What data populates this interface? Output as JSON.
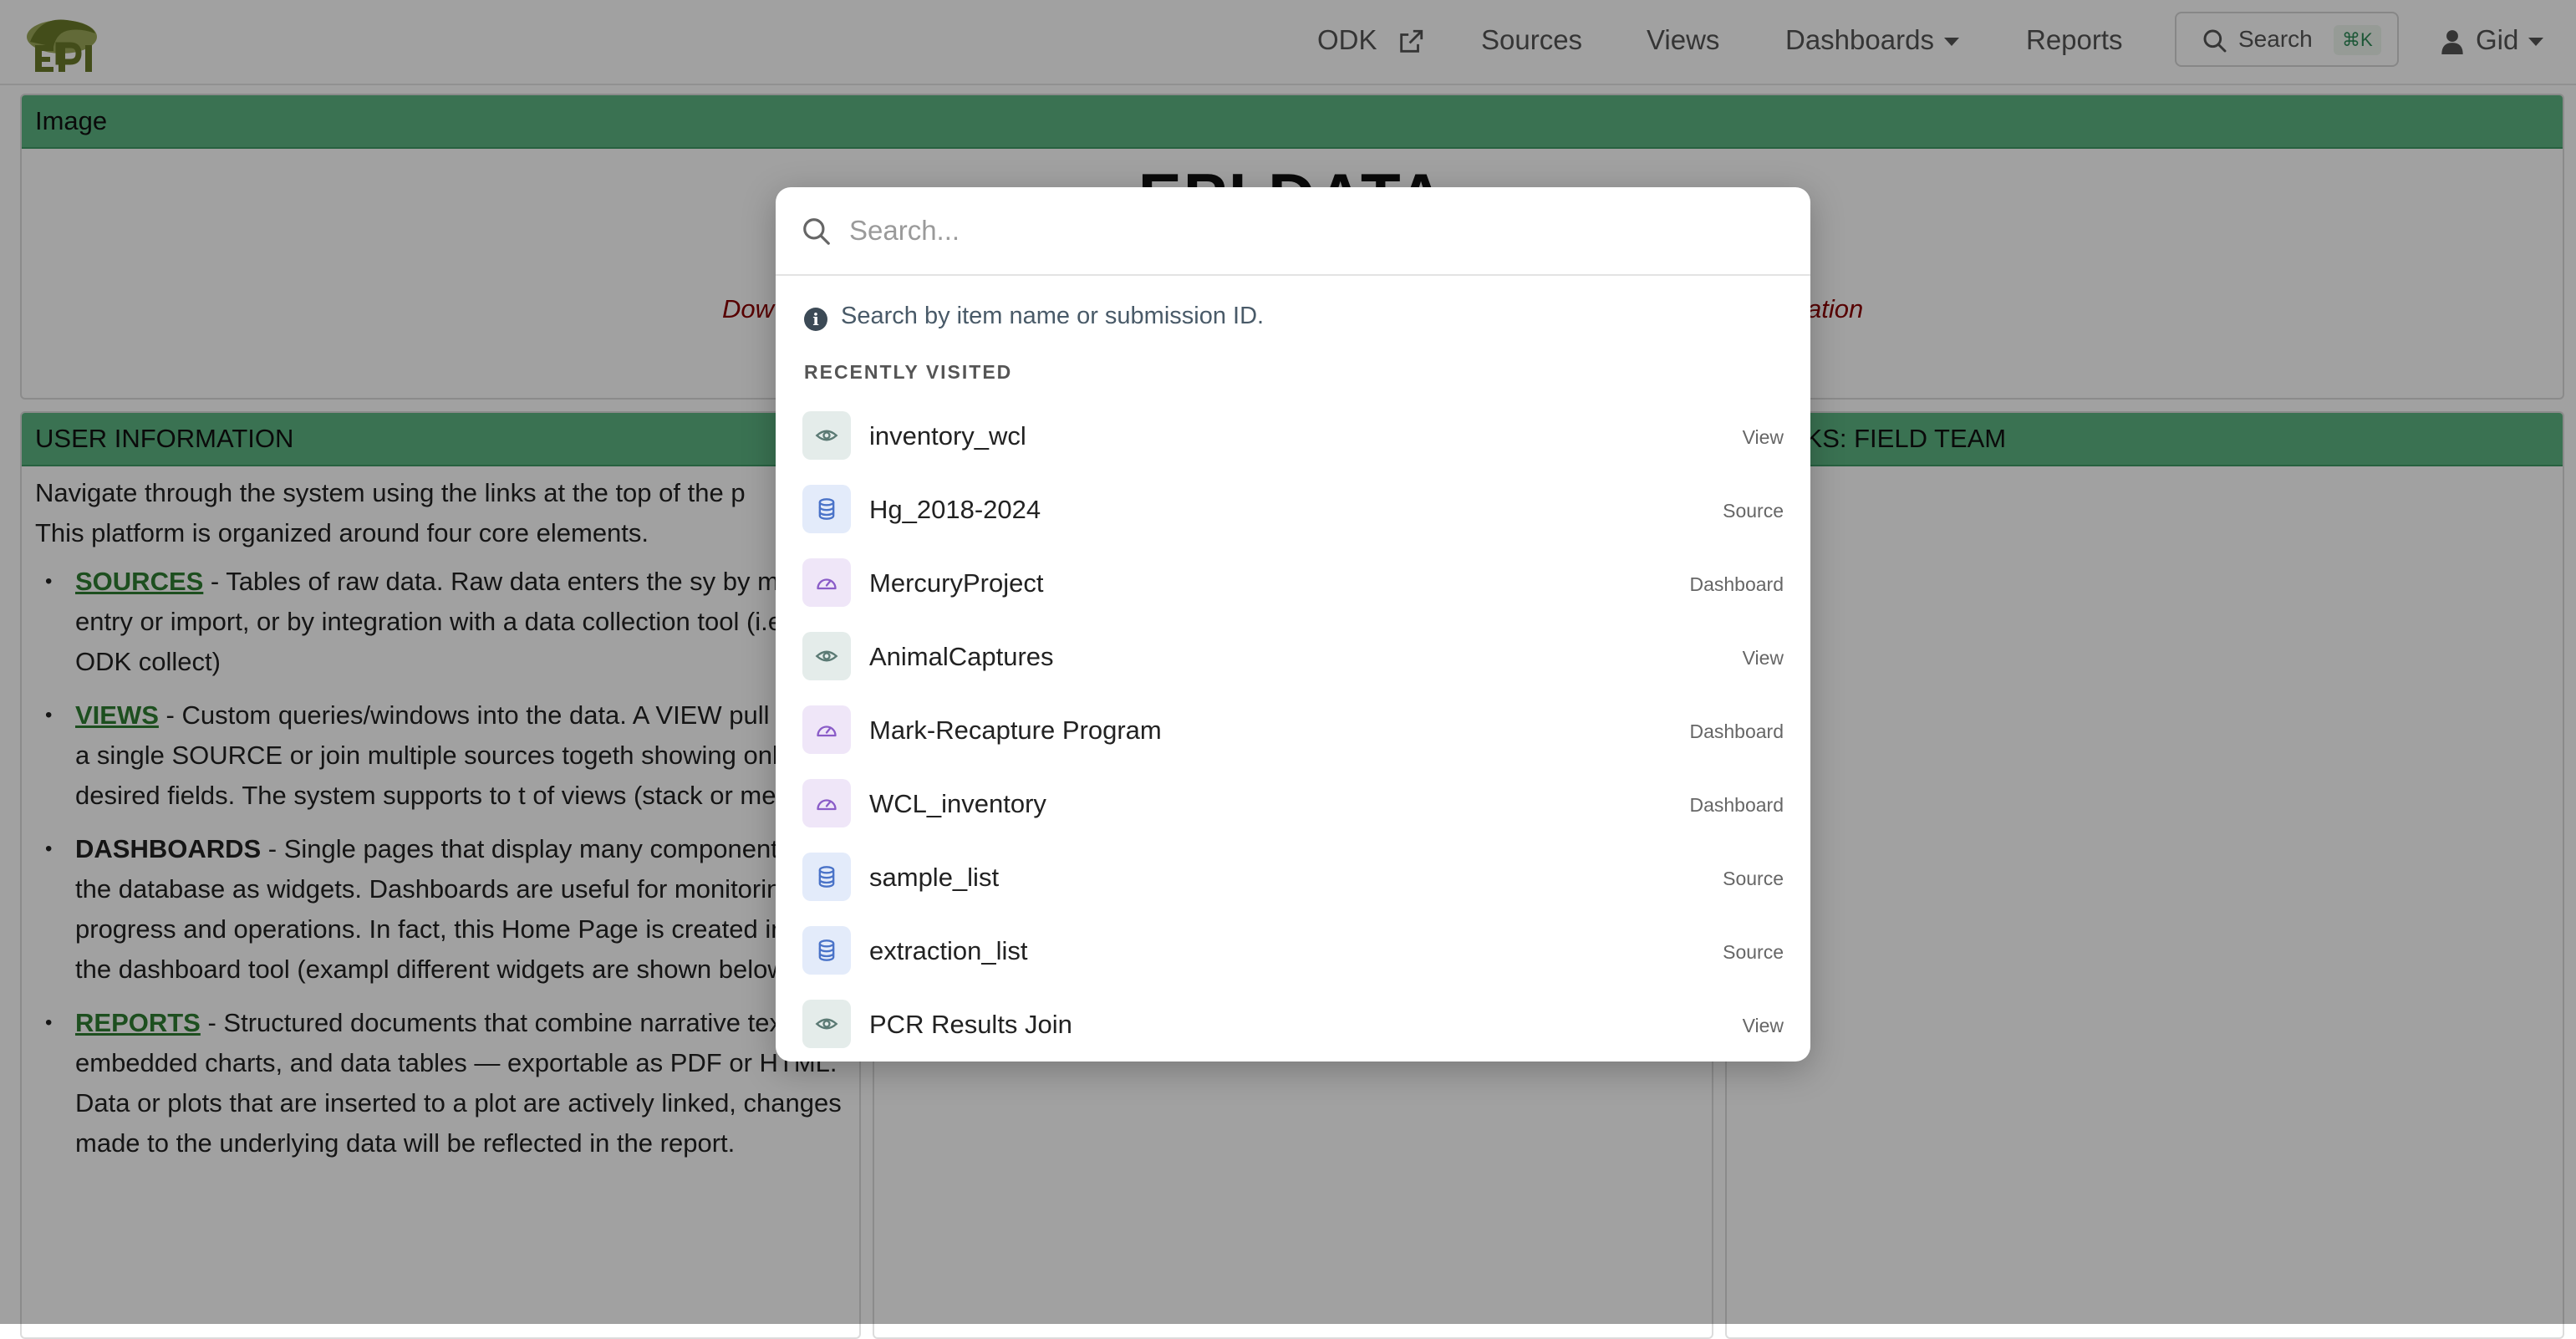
{
  "nav": {
    "odk": "ODK",
    "sources": "Sources",
    "views": "Views",
    "dashboards": "Dashboards",
    "reports": "Reports",
    "search_label": "Search",
    "search_shortcut": "⌘K",
    "user": "Gid"
  },
  "image_card": {
    "header": "Image",
    "title": "EPI DATA",
    "red_left": "Dow",
    "red_right": "ation"
  },
  "user_card": {
    "header": "USER INFORMATION",
    "intro_1": "Navigate through the system using the links at the top of the p",
    "intro_2": "This platform is organized around four core elements.",
    "sources_link": "SOURCES",
    "sources_text": " - Tables of raw data. Raw data enters the sy by manual entry or import, or by integration with a data collection tool (i.e. ODK collect)",
    "views_link": "VIEWS",
    "views_text": " - Custom queries/windows into the data. A VIEW pull from a single SOURCE or join multiple sources togeth showing only the desired fields. The system supports to t of views (stack or merge)",
    "dashboards_link": "DASHBOARDS",
    "dashboards_text": " - Single pages that display many components of the database as widgets. Dashboards are useful for monitoring progress and operations. In fact, this Home Page is created in with the dashboard tool (exampl different widgets are shown below).",
    "reports_link": "REPORTS",
    "reports_text": " - Structured documents that combine narrative text, embedded charts, and data tables — exportable as PDF or HTML. Data or plots that are inserted to a plot are actively linked, changes made to the underlying data will be reflected in the report."
  },
  "right_card": {
    "header": "K LINKS: FIELD TEAM"
  },
  "search_modal": {
    "placeholder": "Search...",
    "hint": "Search by item name or submission ID.",
    "section": "RECENTLY VISITED",
    "items": [
      {
        "name": "inventory_wcl",
        "type": "View",
        "icon": "eye-icon"
      },
      {
        "name": "Hg_2018-2024",
        "type": "Source",
        "icon": "database-icon"
      },
      {
        "name": "MercuryProject",
        "type": "Dashboard",
        "icon": "gauge-icon"
      },
      {
        "name": "AnimalCaptures",
        "type": "View",
        "icon": "eye-icon"
      },
      {
        "name": "Mark-Recapture Program",
        "type": "Dashboard",
        "icon": "gauge-icon"
      },
      {
        "name": "WCL_inventory",
        "type": "Dashboard",
        "icon": "gauge-icon"
      },
      {
        "name": "sample_list",
        "type": "Source",
        "icon": "database-icon"
      },
      {
        "name": "extraction_list",
        "type": "Source",
        "icon": "database-icon"
      },
      {
        "name": "PCR Results Join",
        "type": "View",
        "icon": "eye-icon"
      }
    ]
  },
  "colors": {
    "header_green": "#5cb582",
    "link_green": "#2e7d32",
    "alert_red": "#8b0000"
  }
}
